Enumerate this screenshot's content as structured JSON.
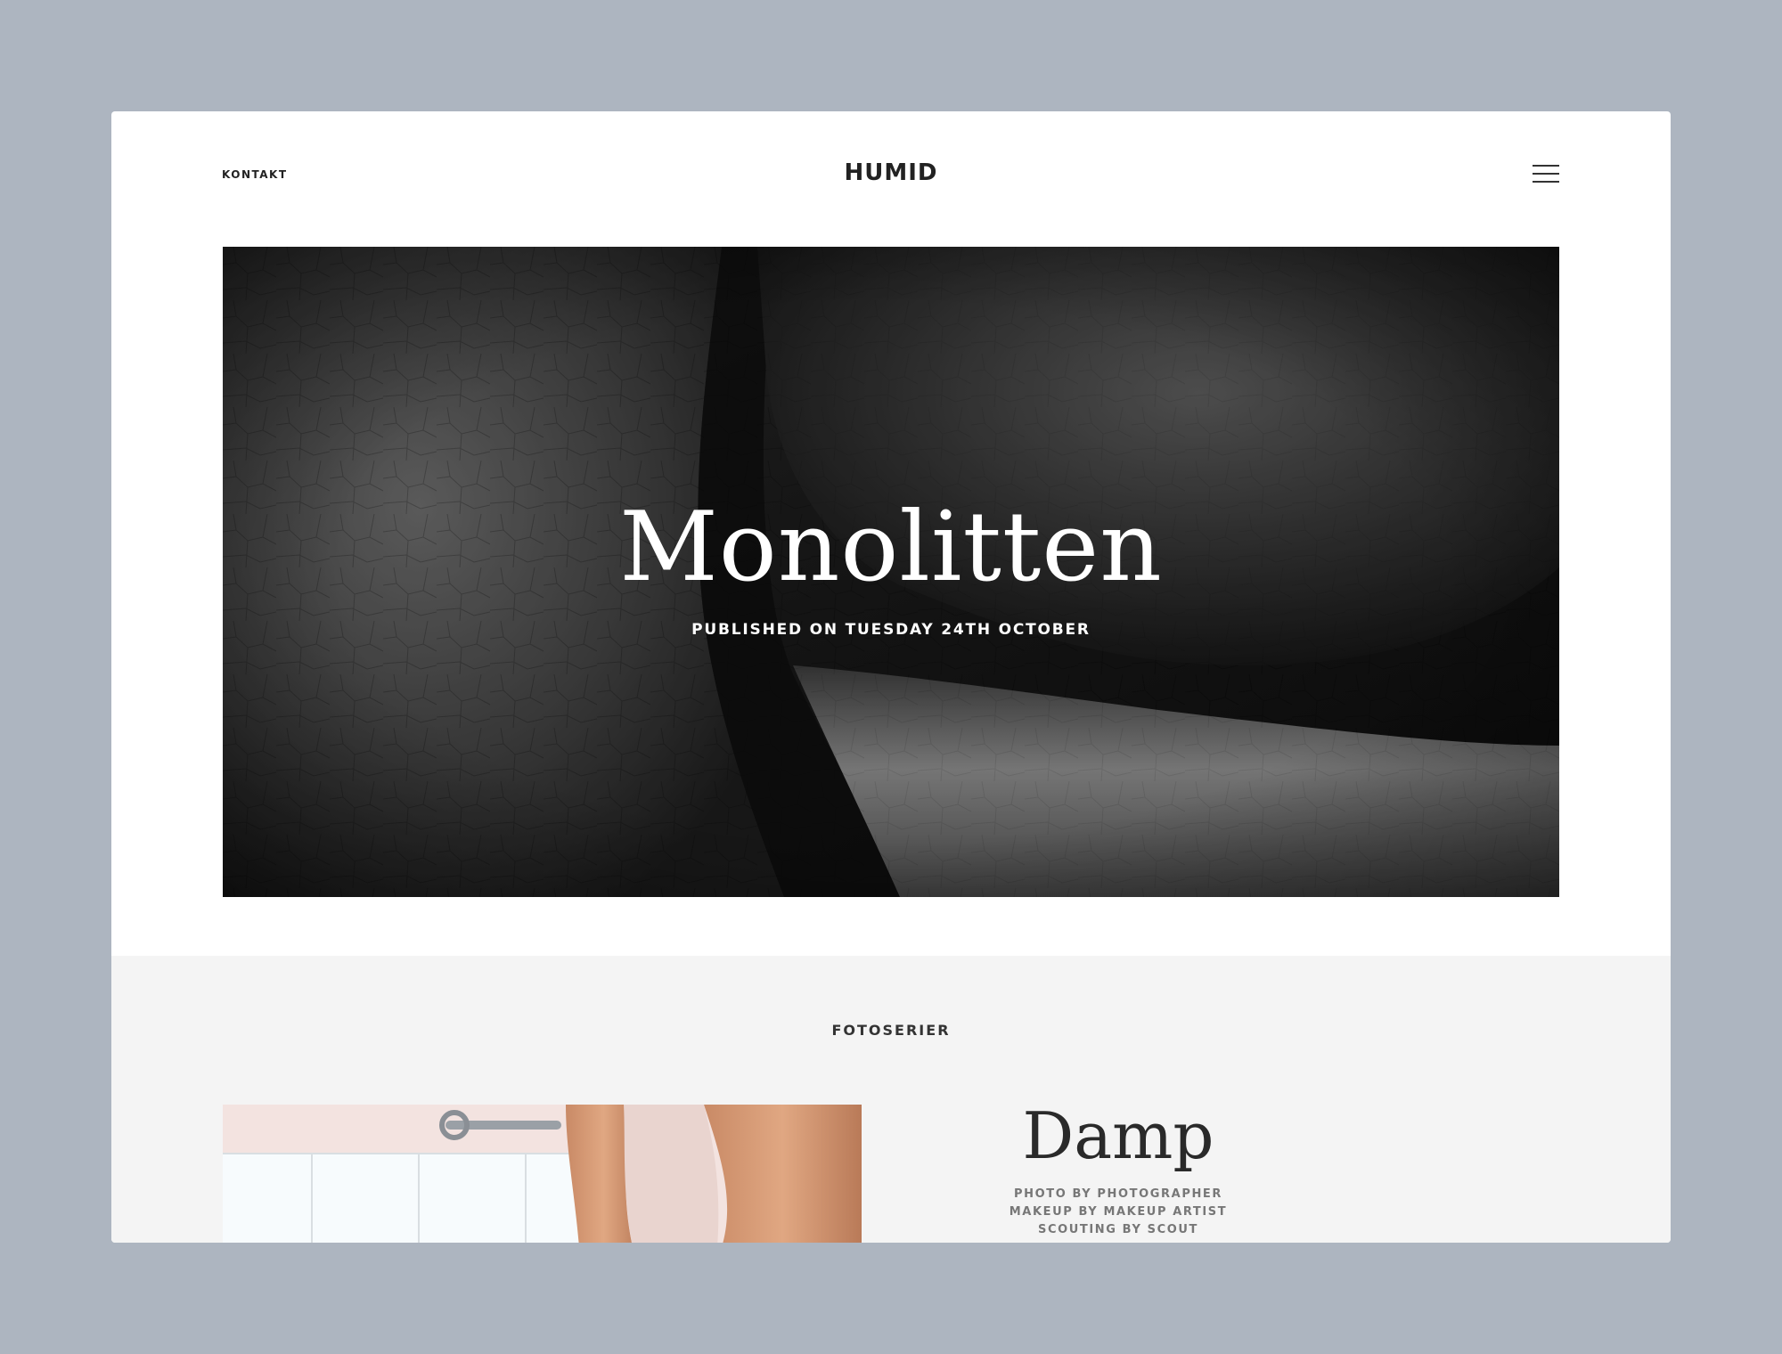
{
  "header": {
    "contact_label": "KONTAKT",
    "logo": "HUMID",
    "menu_icon": "hamburger-menu-icon"
  },
  "hero": {
    "title": "Monolitten",
    "published": "PUBLISHED ON TUESDAY 24TH OCTOBER"
  },
  "section": {
    "heading": "FOTOSERIER"
  },
  "post": {
    "title": "Damp",
    "credits": [
      "PHOTO BY PHOTOGRAPHER",
      "MAKEUP BY MAKEUP ARTIST",
      "SCOUTING BY SCOUT"
    ]
  },
  "colors": {
    "backdrop": "#adb5c0",
    "page": "#ffffff",
    "section_bg": "#f4f4f4",
    "text": "#222222",
    "muted": "#777777"
  }
}
